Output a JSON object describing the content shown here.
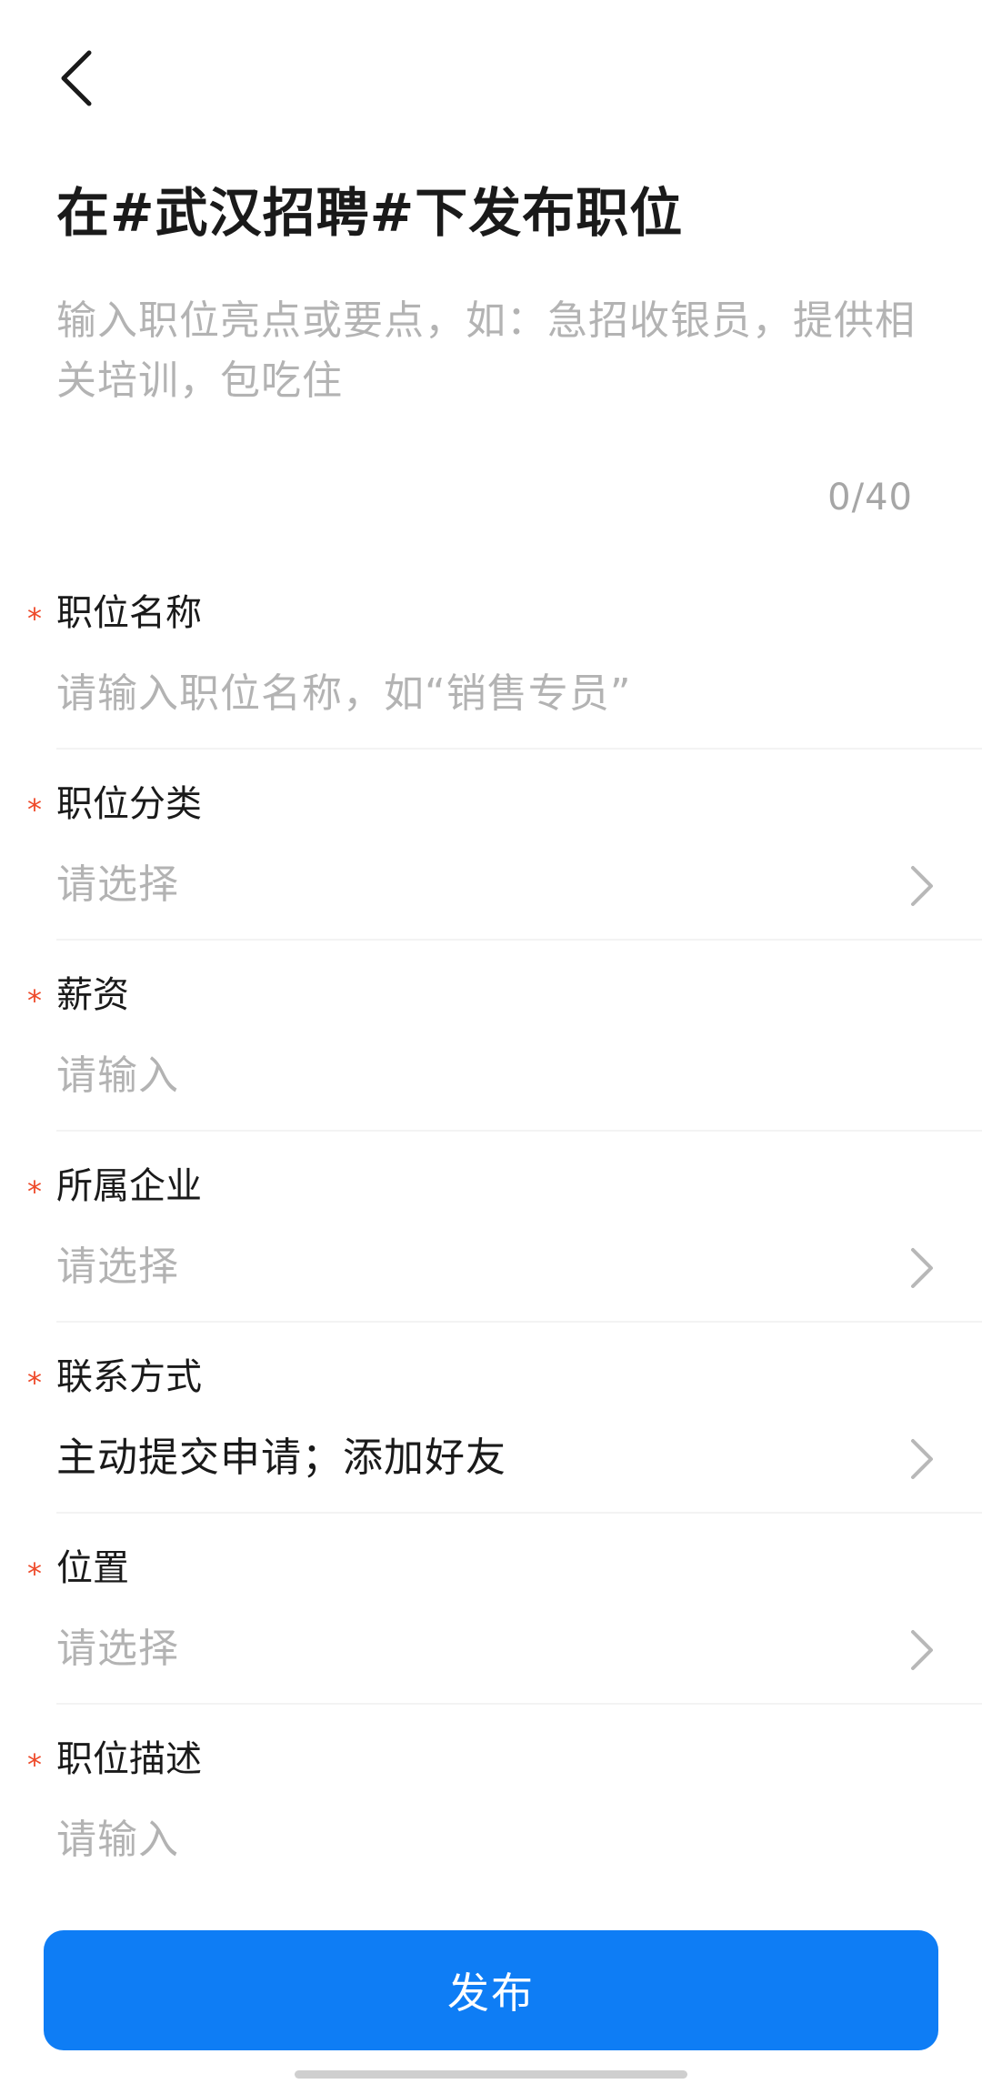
{
  "header": {
    "back_icon": "chevron-left-icon",
    "title": "在#武汉招聘#下发布职位"
  },
  "highlights": {
    "placeholder": "输入职位亮点或要点，如：急招收银员，提供相关培训，包吃住",
    "char_count": "0/40"
  },
  "required_mark": "*",
  "fields": [
    {
      "label": "职位名称",
      "value": "请输入职位名称，如“销售专员”",
      "filled": false,
      "has_chevron": false
    },
    {
      "label": "职位分类",
      "value": "请选择",
      "filled": false,
      "has_chevron": true
    },
    {
      "label": "薪资",
      "value": "请输入",
      "filled": false,
      "has_chevron": false
    },
    {
      "label": "所属企业",
      "value": "请选择",
      "filled": false,
      "has_chevron": true
    },
    {
      "label": "联系方式",
      "value": "主动提交申请；添加好友",
      "filled": true,
      "has_chevron": true
    },
    {
      "label": "位置",
      "value": "请选择",
      "filled": false,
      "has_chevron": true
    },
    {
      "label": "职位描述",
      "value": "请输入",
      "filled": false,
      "has_chevron": false
    }
  ],
  "publish_button": {
    "label": "发布"
  },
  "colors": {
    "accent": "#0e7df5",
    "required": "#ee4a2a",
    "placeholder": "#b3b3b3",
    "text": "#1a1a1a"
  }
}
